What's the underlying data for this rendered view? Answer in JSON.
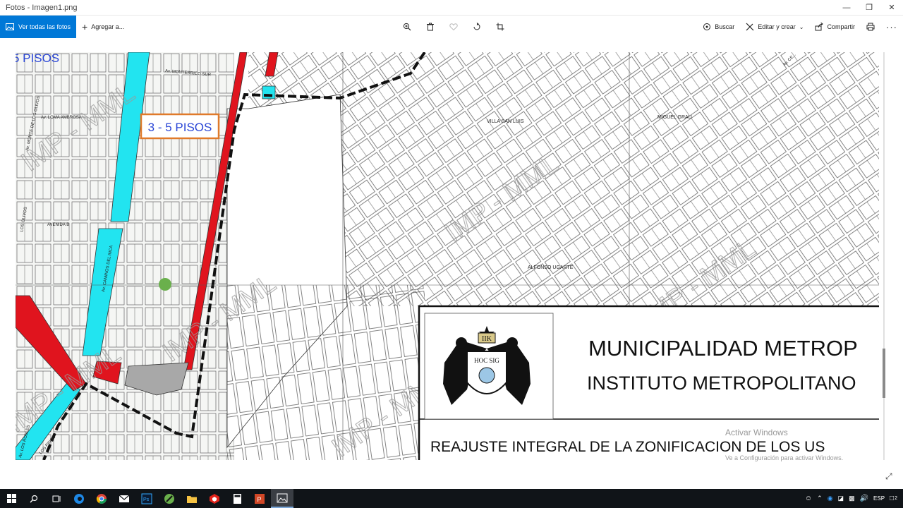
{
  "window": {
    "title": "Fotos - Imagen1.png"
  },
  "toolbar": {
    "view_all_label": "Ver todas las fotos",
    "add_to_label": "Agregar a...",
    "search_label": "Buscar",
    "edit_create_label": "Editar y crear",
    "share_label": "Compartir"
  },
  "map": {
    "floors_label_top": "5 PISOS",
    "floors_label_box": "3 - 5 PISOS",
    "streets": {
      "monterrico": "Av. MONTERRICO SUR",
      "loma": "Av. LOMA AMBROSA",
      "monte_olivos": "Av. MONTE DE LOS OLIVOS",
      "los_olivos": "LOS OLIVOS",
      "avenida_b": "AVENIDA B",
      "caminos_inca": "Av. CAMINOS DEL INCA",
      "los_robles": "Av. LOS ROBLES",
      "los_pinos": "LOS PINOS",
      "villa_san_luis": "VILLA SAN LUIS",
      "miguel_grau": "MIGUEL GRAU",
      "alfonso_ugarte": "ALFONSO UGARTE",
      "av_ne": "Av. CE..."
    },
    "watermark": "IMP - MML",
    "title_block": {
      "line1": "MUNICIPALIDAD METROP",
      "line2": "INSTITUTO METROPOLITANO",
      "line3": "REAJUSTE INTEGRAL DE LA ZONIFICACION DE LOS US",
      "seal_text_top": "HOC SIG",
      "seal_monogram": "IIK"
    }
  },
  "activation": {
    "line1": "Activar Windows",
    "line2": "Ve a Configuración para activar Windows."
  },
  "tray": {
    "language": "ESP",
    "notifications": "2"
  },
  "colors": {
    "accent": "#0078d7",
    "zone_red": "#e0141e",
    "zone_cyan": "#22e4f0",
    "label_blue": "#2a46d6",
    "box_orange": "#e07a2a",
    "green_dot": "#6ab04c",
    "gray_area": "#a8a8a8",
    "taskbar": "#101418"
  }
}
